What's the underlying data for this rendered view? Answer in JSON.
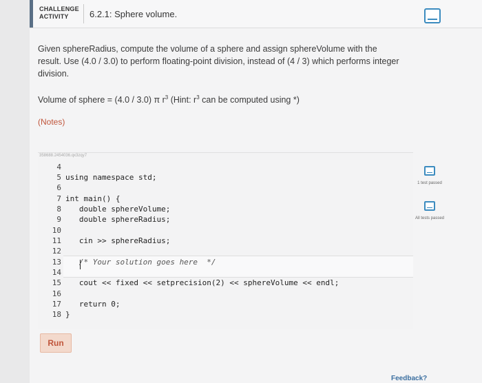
{
  "header": {
    "badge_line1": "CHALLENGE",
    "badge_line2": "ACTIVITY",
    "title": "6.2.1: Sphere volume."
  },
  "prompt": "Given sphereRadius, compute the volume of a sphere and assign sphereVolume with the result. Use (4.0 / 3.0) to perform floating-point division, instead of (4 / 3) which performs integer division.",
  "formula": {
    "prefix": "Volume of sphere = (4.0 / 3.0) π r",
    "sup1": "3",
    "middle": " (Hint: r",
    "sup2": "3",
    "suffix": " can be computed using *)"
  },
  "notes": "(Notes)",
  "watermark": "358688.2454036.qx3zqy7",
  "line_numbers": [
    "4",
    "5",
    "6",
    "7",
    "8",
    "9",
    "10",
    "11",
    "12",
    "13",
    "14",
    "15",
    "16",
    "17",
    "18"
  ],
  "code_lines": [
    "",
    "using namespace std;",
    "",
    "int main() {",
    "   double sphereVolume;",
    "   double sphereRadius;",
    "",
    "   cin >> sphereRadius;",
    "",
    "   /* Your solution goes here  */",
    "",
    "   cout << fixed << setprecision(2) << sphereVolume << endl;",
    "",
    "   return 0;",
    "}"
  ],
  "status": {
    "test1": "1 test passed",
    "all": "All tests passed"
  },
  "run_label": "Run",
  "feedback": "Feedback?"
}
